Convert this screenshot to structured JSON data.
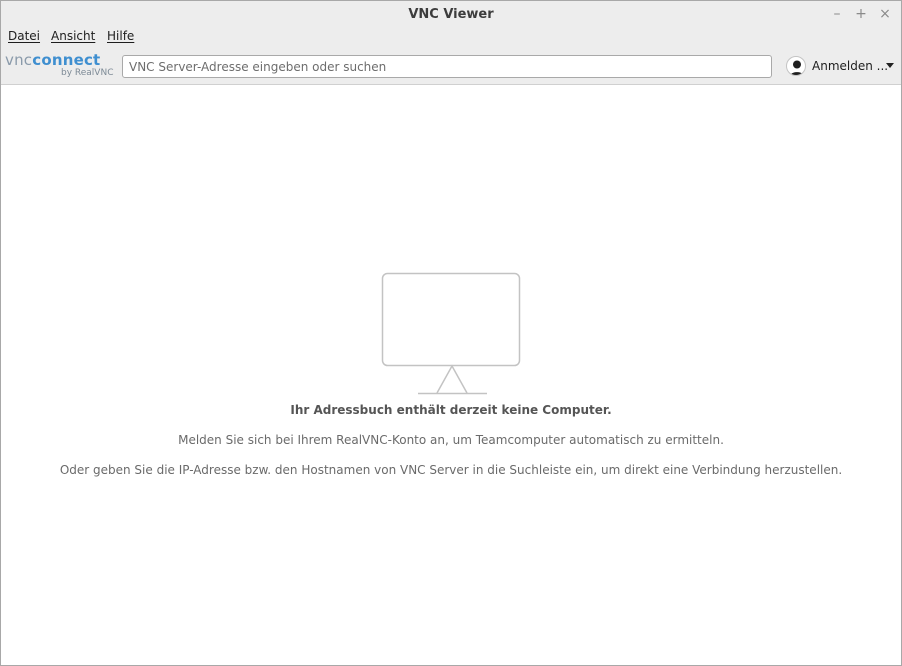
{
  "window": {
    "title": "VNC Viewer",
    "controls": {
      "minimize": "–",
      "maximize": "+",
      "close": "×"
    }
  },
  "menu": {
    "items": [
      "Datei",
      "Ansicht",
      "Hilfe"
    ]
  },
  "toolbar": {
    "logo": {
      "vnc": "vnc",
      "connect": "connect",
      "sub": "by RealVNC"
    },
    "search": {
      "placeholder": "VNC Server-Adresse eingeben oder suchen",
      "value": ""
    },
    "account": {
      "label": "Anmelden ...",
      "icon": "user-avatar-icon"
    }
  },
  "main": {
    "empty_icon": "monitor-icon",
    "empty_title": "Ihr Adressbuch enthält derzeit keine Computer.",
    "empty_line1": "Melden Sie sich bei Ihrem RealVNC-Konto an, um Teamcomputer automatisch zu ermitteln.",
    "empty_line2": "Oder geben Sie die IP-Adresse bzw. den Hostnamen von VNC Server in die Suchleiste ein, um direkt eine Verbindung herzustellen."
  },
  "colors": {
    "brand_blue": "#3f8fd0",
    "chrome_bg": "#ededed",
    "monitor_stroke": "#c3c3c3"
  }
}
